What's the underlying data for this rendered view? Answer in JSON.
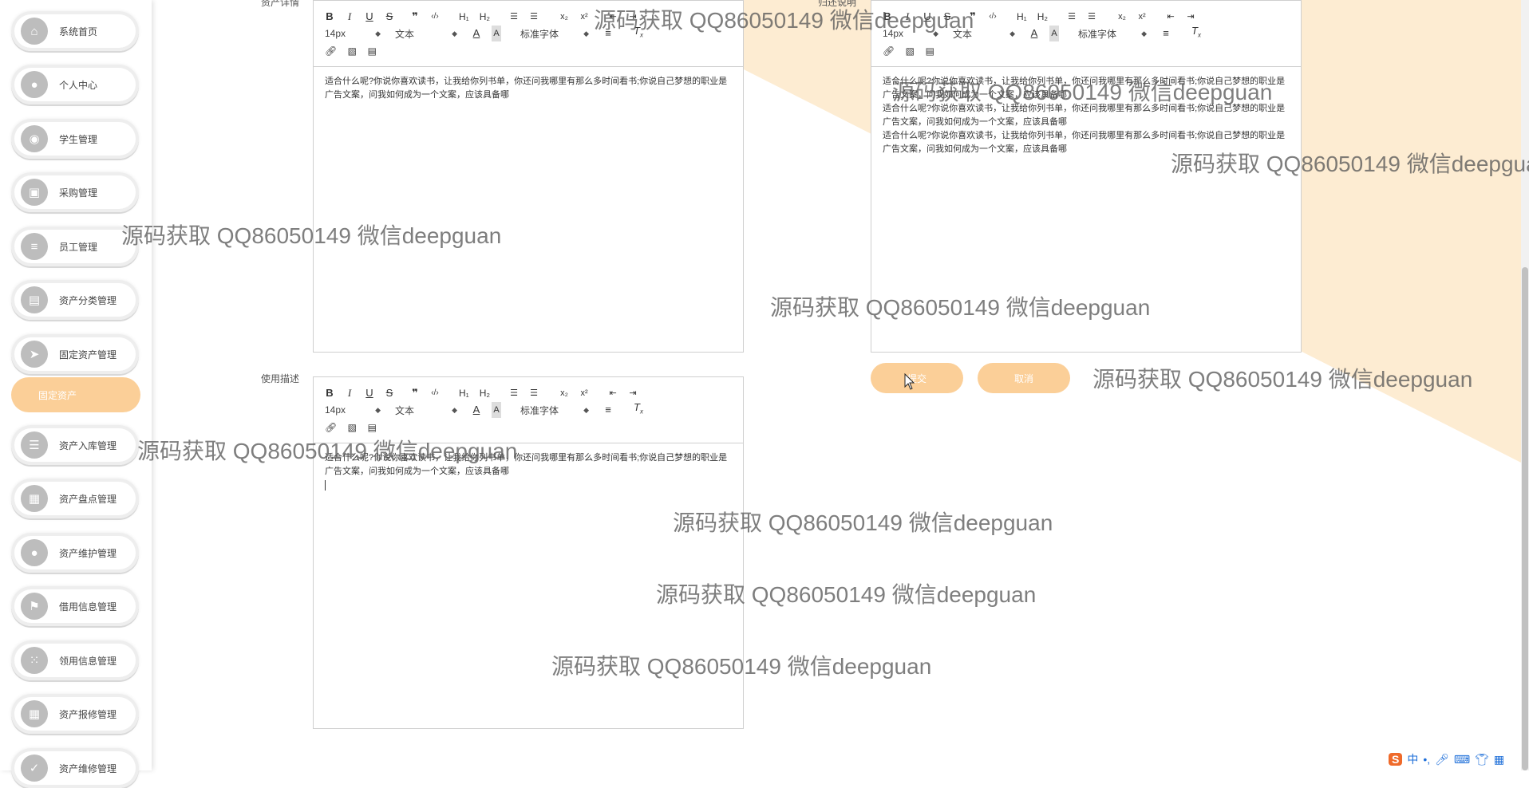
{
  "theme": {
    "accent": "#fbcf98",
    "peach_bg": "#fdecd2",
    "icon_gray": "#bdbdbd"
  },
  "sidebar": {
    "items": [
      {
        "label": "系统首页",
        "icon": "home-icon"
      },
      {
        "label": "个人中心",
        "icon": "user-icon"
      },
      {
        "label": "学生管理",
        "icon": "location-pin-icon"
      },
      {
        "label": "采购管理",
        "icon": "briefcase-icon"
      },
      {
        "label": "员工管理",
        "icon": "list-icon"
      },
      {
        "label": "资产分类管理",
        "icon": "document-icon"
      },
      {
        "label": "固定资产管理",
        "icon": "send-icon"
      },
      {
        "label": "资产入库管理",
        "icon": "sliders-icon"
      },
      {
        "label": "资产盘点管理",
        "icon": "grid-icon"
      },
      {
        "label": "资产维护管理",
        "icon": "user-icon"
      },
      {
        "label": "借用信息管理",
        "icon": "flag-icon"
      },
      {
        "label": "领用信息管理",
        "icon": "apps-icon"
      },
      {
        "label": "资产报修管理",
        "icon": "grid-icon"
      },
      {
        "label": "资产维修管理",
        "icon": "check-icon"
      }
    ],
    "sub_item": "固定资产"
  },
  "form": {
    "field1_label": "资产详情",
    "field2_label": "归还说明",
    "field3_label": "使用描述"
  },
  "toolbar": {
    "font_size": "14px",
    "text_type": "文本",
    "font_family": "标准字体"
  },
  "editors": {
    "detail_text": "适合什么呢?你说你喜欢读书，让我给你列书单，你还问我哪里有那么多时间看书;你说自己梦想的职业是广告文案，问我如何成为一个文案，应该具备哪",
    "return_lines": [
      "适合什么呢?你说你喜欢读书，让我给你列书单，你还问我哪里有那么多时间看书;你说自己梦想的职业是广告文案，问我如何成为一个文案，应该具备哪",
      "适合什么呢?你说你喜欢读书，让我给你列书单，你还问我哪里有那么多时间看书;你说自己梦想的职业是广告文案，问我如何成为一个文案，应该具备哪",
      "适合什么呢?你说你喜欢读书，让我给你列书单，你还问我哪里有那么多时间看书;你说自己梦想的职业是广告文案，问我如何成为一个文案，应该具备哪"
    ],
    "usage_text": "适合什么呢?你说你喜欢读书，让我给你列书单，你还问我哪里有那么多时间看书;你说自己梦想的职业是广告文案，问我如何成为一个文案，应该具备哪"
  },
  "buttons": {
    "submit": "提交",
    "cancel": "取消"
  },
  "watermark": "源码获取 QQ86050149 微信deepguan",
  "ime": {
    "logo": "S",
    "lang": "中"
  }
}
